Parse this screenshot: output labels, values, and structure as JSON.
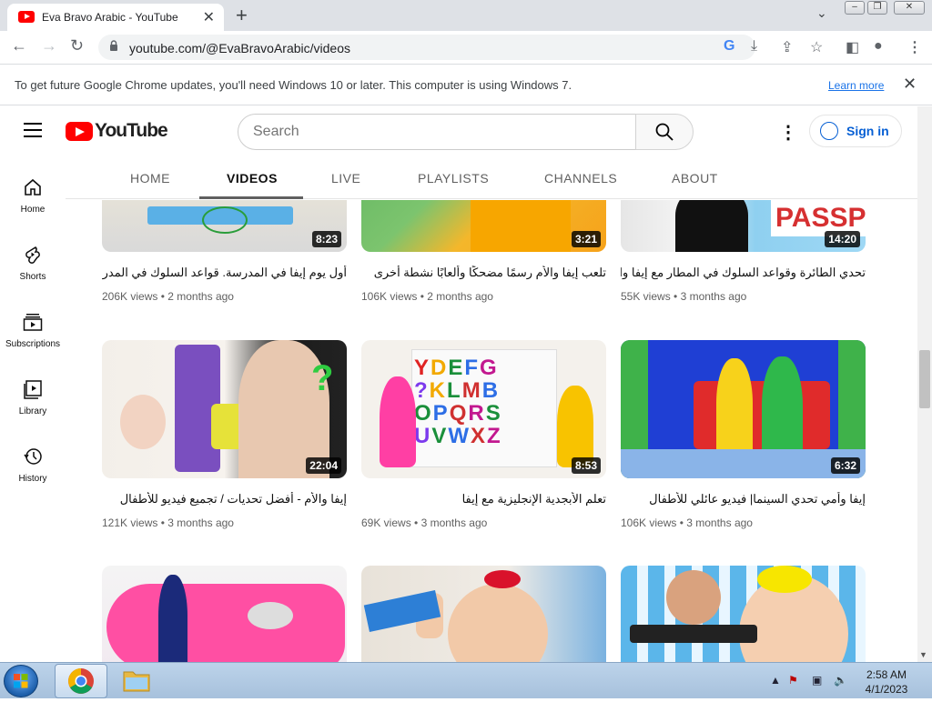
{
  "browser": {
    "tab_title": "Eva Bravo Arabic - YouTube",
    "url": "youtube.com/@EvaBravoArabic/videos",
    "infobar_message": "To get future Google Chrome updates, you'll need Windows 10 or later. This computer is using Windows 7.",
    "infobar_link": "Learn more"
  },
  "youtube": {
    "logo_text": "YouTube",
    "search_placeholder": "Search",
    "signin_label": "Sign in",
    "tabs": [
      "HOME",
      "VIDEOS",
      "LIVE",
      "PLAYLISTS",
      "CHANNELS",
      "ABOUT"
    ],
    "active_tab": "VIDEOS",
    "rail": [
      "Home",
      "Shorts",
      "Subscriptions",
      "Library",
      "History"
    ]
  },
  "videos": [
    {
      "title": "أول يوم إيفا في المدرسة. قواعد السلوك في المدرسة",
      "views": "206K views",
      "age": "2 months ago",
      "duration": "8:23"
    },
    {
      "title": "تلعب إيفا والأم رسمًا مضحكًا وألعابًا نشطة أخرى",
      "views": "106K views",
      "age": "2 months ago",
      "duration": "3:21"
    },
    {
      "title": "تحدي الطائرة وقواعد السلوك في المطار مع إيفا والأم",
      "views": "55K views",
      "age": "3 months ago",
      "duration": "14:20"
    },
    {
      "title": "إيفا والأم - أفضل تحديات / تجميع فيديو للأطفال",
      "views": "121K views",
      "age": "3 months ago",
      "duration": "22:04"
    },
    {
      "title": "تعلم الأبجدية الإنجليزية مع إيفا",
      "views": "69K views",
      "age": "3 months ago",
      "duration": "8:53"
    },
    {
      "title": "إيفا وأمي تحدي السينما| فيديو عائلي للأطفال",
      "views": "106K views",
      "age": "3 months ago",
      "duration": "6:32"
    },
    {
      "title": "",
      "views": "",
      "age": "",
      "duration": ""
    },
    {
      "title": "",
      "views": "",
      "age": "",
      "duration": ""
    },
    {
      "title": "",
      "views": "",
      "age": "",
      "duration": ""
    }
  ],
  "taskbar": {
    "time": "2:58 AM",
    "date": "4/1/2023"
  }
}
